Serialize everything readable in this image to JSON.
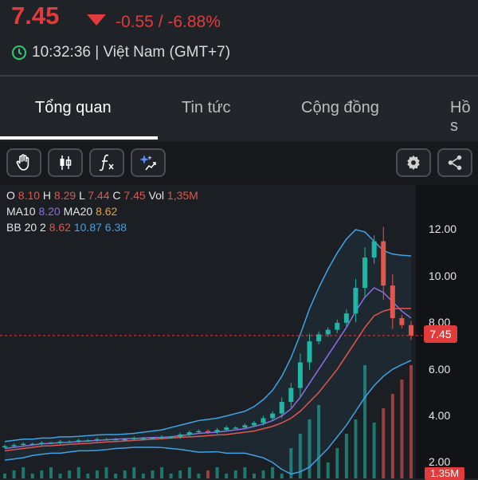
{
  "header": {
    "price": "7.45",
    "change": "-0.55 / -6.88%",
    "time": "10:32:36 | Việt Nam (GMT+7)",
    "clock_icon": "clock-icon",
    "trend_icon": "down-triangle-icon",
    "colors": {
      "down": "#e23b3b",
      "up": "#1fb6a6"
    }
  },
  "tabs": [
    {
      "label": "Tổng quan",
      "active": true
    },
    {
      "label": "Tin tức",
      "active": false
    },
    {
      "label": "Cộng đồng",
      "active": false
    },
    {
      "label": "Hồ s",
      "active": false
    }
  ],
  "toolbar": {
    "left_icons": [
      "hand-icon",
      "candlestick-icon",
      "function-icon",
      "ai-sparkle-icon"
    ],
    "right_icons": [
      "gear-icon",
      "share-icon"
    ]
  },
  "legend": {
    "ohlc": [
      {
        "k": "O",
        "v": "8.10"
      },
      {
        "k": "H",
        "v": "8.29"
      },
      {
        "k": "L",
        "v": "7.44"
      },
      {
        "k": "C",
        "v": "7.45"
      },
      {
        "k": "Vol",
        "v": "1,35M"
      }
    ],
    "ma": [
      {
        "k": "MA10",
        "v": "8.20"
      },
      {
        "k": "MA20",
        "v": "8.62"
      }
    ],
    "bb": {
      "label": "BB 20 2",
      "v1": "8.62",
      "v2": "10.87",
      "v3": "6.38"
    }
  },
  "chart_data": {
    "type": "candlestick",
    "y_ticks": [
      "12.00",
      "10.00",
      "8.00",
      "6.00",
      "4.00",
      "2.00"
    ],
    "y_tick_values": [
      12,
      10,
      8,
      6,
      4,
      2
    ],
    "ylim": [
      1.5,
      13
    ],
    "current_price_label": "7.45",
    "current_price": 7.45,
    "volume_label": "1.35M",
    "series": [
      {
        "name": "Close",
        "values": [
          2.7,
          2.75,
          2.8,
          2.8,
          2.85,
          2.85,
          2.9,
          2.9,
          2.95,
          2.95,
          3.0,
          3.0,
          3.0,
          3.0,
          3.05,
          3.05,
          3.05,
          3.1,
          3.1,
          3.2,
          3.3,
          3.35,
          3.3,
          3.4,
          3.5,
          3.5,
          3.6,
          3.7,
          3.9,
          4.1,
          4.6,
          5.2,
          6.3,
          7.2,
          7.5,
          7.7,
          8.0,
          8.4,
          9.5,
          10.8,
          11.5,
          9.6,
          8.2,
          7.9,
          7.45
        ]
      },
      {
        "name": "MA10",
        "values": [
          2.6,
          2.65,
          2.7,
          2.75,
          2.8,
          2.82,
          2.85,
          2.87,
          2.9,
          2.92,
          2.95,
          2.97,
          3.0,
          3.02,
          3.03,
          3.05,
          3.07,
          3.08,
          3.1,
          3.15,
          3.2,
          3.25,
          3.28,
          3.3,
          3.35,
          3.4,
          3.45,
          3.55,
          3.65,
          3.8,
          4.0,
          4.3,
          4.8,
          5.4,
          6.0,
          6.6,
          7.2,
          7.8,
          8.5,
          9.1,
          9.5,
          9.3,
          8.9,
          8.5,
          8.2
        ]
      },
      {
        "name": "MA20",
        "values": [
          2.5,
          2.55,
          2.6,
          2.65,
          2.7,
          2.72,
          2.75,
          2.78,
          2.8,
          2.82,
          2.85,
          2.88,
          2.9,
          2.92,
          2.95,
          2.97,
          3.0,
          3.02,
          3.05,
          3.08,
          3.1,
          3.12,
          3.15,
          3.18,
          3.2,
          3.25,
          3.3,
          3.35,
          3.45,
          3.55,
          3.7,
          3.9,
          4.2,
          4.6,
          5.0,
          5.5,
          6.0,
          6.6,
          7.2,
          7.8,
          8.3,
          8.5,
          8.6,
          8.62,
          8.62
        ]
      },
      {
        "name": "BB upper",
        "values": [
          2.9,
          2.95,
          3.0,
          3.0,
          3.05,
          3.05,
          3.1,
          3.1,
          3.12,
          3.15,
          3.18,
          3.2,
          3.2,
          3.22,
          3.25,
          3.3,
          3.35,
          3.4,
          3.5,
          3.6,
          3.7,
          3.8,
          3.85,
          3.9,
          4.0,
          4.1,
          4.2,
          4.4,
          4.7,
          5.1,
          5.7,
          6.5,
          7.5,
          8.6,
          9.5,
          10.3,
          11.0,
          11.6,
          12.0,
          11.9,
          11.5,
          11.1,
          10.95,
          10.9,
          10.87
        ]
      },
      {
        "name": "BB lower",
        "values": [
          2.1,
          2.15,
          2.2,
          2.3,
          2.35,
          2.4,
          2.4,
          2.45,
          2.5,
          2.5,
          2.52,
          2.55,
          2.6,
          2.62,
          2.65,
          2.65,
          2.65,
          2.64,
          2.6,
          2.56,
          2.5,
          2.44,
          2.45,
          2.46,
          2.4,
          2.4,
          2.4,
          2.3,
          2.2,
          2.0,
          1.7,
          1.5,
          1.6,
          1.8,
          2.2,
          2.6,
          3.1,
          3.6,
          4.2,
          4.8,
          5.3,
          5.7,
          6.0,
          6.2,
          6.38
        ]
      }
    ],
    "grid": false,
    "legend_placement": "top-left"
  }
}
